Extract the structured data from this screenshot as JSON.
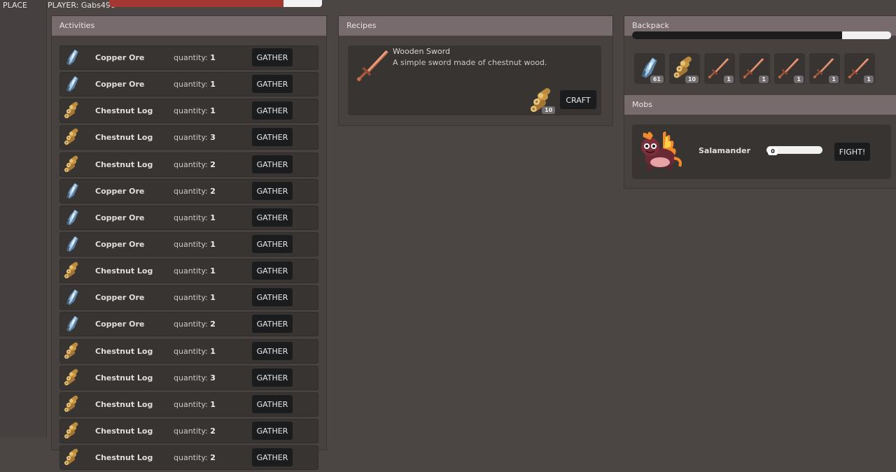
{
  "header": {
    "place_label": "PLACE",
    "player_label": "PLAYER: Gabs496",
    "hp_fraction": 0.82
  },
  "activities": {
    "title": "Activities",
    "qty_prefix": "quantity:",
    "rows": [
      {
        "icon": "copper-ore-icon",
        "name": "Copper Ore",
        "quantity": "1",
        "button": "GATHER"
      },
      {
        "icon": "copper-ore-icon",
        "name": "Copper Ore",
        "quantity": "1",
        "button": "GATHER"
      },
      {
        "icon": "chestnut-log-icon",
        "name": "Chestnut Log",
        "quantity": "1",
        "button": "GATHER"
      },
      {
        "icon": "chestnut-log-icon",
        "name": "Chestnut Log",
        "quantity": "3",
        "button": "GATHER"
      },
      {
        "icon": "chestnut-log-icon",
        "name": "Chestnut Log",
        "quantity": "2",
        "button": "GATHER"
      },
      {
        "icon": "copper-ore-icon",
        "name": "Copper Ore",
        "quantity": "2",
        "button": "GATHER"
      },
      {
        "icon": "copper-ore-icon",
        "name": "Copper Ore",
        "quantity": "1",
        "button": "GATHER"
      },
      {
        "icon": "copper-ore-icon",
        "name": "Copper Ore",
        "quantity": "1",
        "button": "GATHER"
      },
      {
        "icon": "chestnut-log-icon",
        "name": "Chestnut Log",
        "quantity": "1",
        "button": "GATHER"
      },
      {
        "icon": "copper-ore-icon",
        "name": "Copper Ore",
        "quantity": "1",
        "button": "GATHER"
      },
      {
        "icon": "copper-ore-icon",
        "name": "Copper Ore",
        "quantity": "2",
        "button": "GATHER"
      },
      {
        "icon": "chestnut-log-icon",
        "name": "Chestnut Log",
        "quantity": "1",
        "button": "GATHER"
      },
      {
        "icon": "chestnut-log-icon",
        "name": "Chestnut Log",
        "quantity": "3",
        "button": "GATHER"
      },
      {
        "icon": "chestnut-log-icon",
        "name": "Chestnut Log",
        "quantity": "1",
        "button": "GATHER"
      },
      {
        "icon": "chestnut-log-icon",
        "name": "Chestnut Log",
        "quantity": "2",
        "button": "GATHER"
      },
      {
        "icon": "chestnut-log-icon",
        "name": "Chestnut Log",
        "quantity": "2",
        "button": "GATHER"
      }
    ]
  },
  "recipes": {
    "title": "Recipes",
    "items": [
      {
        "icon": "wooden-sword-icon",
        "name": "Wooden Sword",
        "description": "A simple sword made of chestnut wood.",
        "ingredient_icon": "chestnut-log-icon",
        "ingredient_count": "10",
        "button": "CRAFT"
      }
    ]
  },
  "backpack": {
    "title": "Backpack",
    "capacity_fraction": 0.81,
    "items": [
      {
        "icon": "copper-ore-icon",
        "count": "61"
      },
      {
        "icon": "chestnut-log-icon",
        "count": "10"
      },
      {
        "icon": "wooden-sword-icon",
        "count": "1"
      },
      {
        "icon": "wooden-sword-icon",
        "count": "1"
      },
      {
        "icon": "wooden-sword-icon",
        "count": "1"
      },
      {
        "icon": "wooden-sword-icon",
        "count": "1"
      },
      {
        "icon": "wooden-sword-icon",
        "count": "1"
      }
    ]
  },
  "mobs": {
    "title": "Mobs",
    "items": [
      {
        "icon": "salamander-icon",
        "name": "Salamander",
        "hp_value": "0",
        "button": "FIGHT!"
      }
    ]
  },
  "colors": {
    "background": "#4b4543",
    "panel_header": "#776b6d",
    "card": "#383432",
    "button": "#1b1c1e",
    "hp_red": "#a33833"
  }
}
